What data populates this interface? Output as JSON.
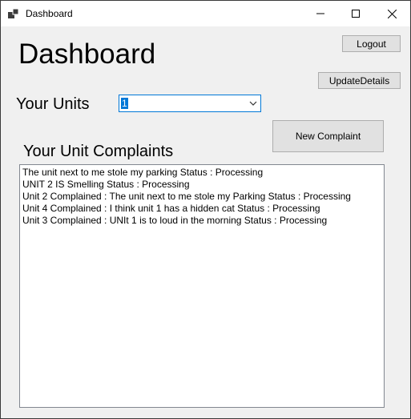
{
  "window": {
    "title": "Dashboard"
  },
  "header": {
    "title": "Dashboard"
  },
  "buttons": {
    "logout": "Logout",
    "update_details": "UpdateDetails",
    "new_complaint": "New Complaint"
  },
  "units": {
    "label": "Your Units",
    "selected": "1"
  },
  "complaints": {
    "label": "Your Unit Complaints",
    "items": [
      "The unit next to me stole my parking Status : Processing",
      "UNIT 2 IS Smelling Status : Processing",
      "Unit 2 Complained : The unit next to me stole my Parking Status : Processing",
      "Unit 4 Complained : I think unit 1 has a hidden cat Status : Processing",
      "Unit 3 Complained : UNIt 1 is to loud in the morning Status : Processing"
    ]
  }
}
